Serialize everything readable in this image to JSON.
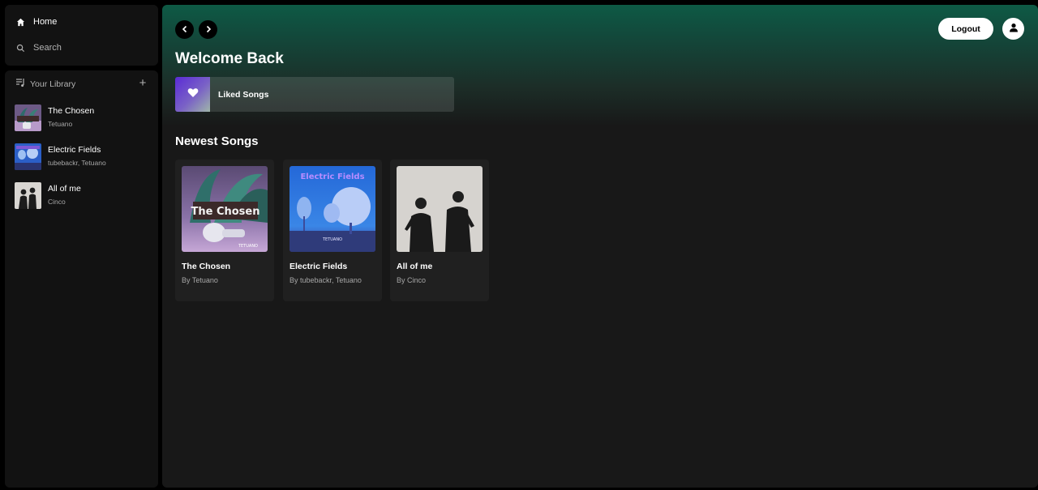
{
  "sidebar": {
    "nav": [
      {
        "label": "Home",
        "icon": "home-icon"
      },
      {
        "label": "Search",
        "icon": "search-icon"
      }
    ],
    "library": {
      "title": "Your Library",
      "items": [
        {
          "title": "The Chosen",
          "subtitle": "Tetuano"
        },
        {
          "title": "Electric Fields",
          "subtitle": "tubebackr, Tetuano"
        },
        {
          "title": "All of me",
          "subtitle": "Cinco"
        }
      ]
    }
  },
  "header": {
    "logout_label": "Logout",
    "greeting": "Welcome Back"
  },
  "liked": {
    "label": "Liked Songs"
  },
  "newest": {
    "title": "Newest Songs",
    "songs": [
      {
        "title": "The Chosen",
        "subtitle": "By Tetuano",
        "art_text": "The Chosen",
        "art_caption": "TETUANO"
      },
      {
        "title": "Electric Fields",
        "subtitle": "By tubebackr, Tetuano",
        "art_text": "Electric Fields",
        "art_caption": "TETUANO"
      },
      {
        "title": "All of me",
        "subtitle": "By Cinco"
      }
    ]
  },
  "colors": {
    "accent": "#0e5a45",
    "panel": "#121212",
    "main_bg": "#181818",
    "card": "#202020"
  }
}
